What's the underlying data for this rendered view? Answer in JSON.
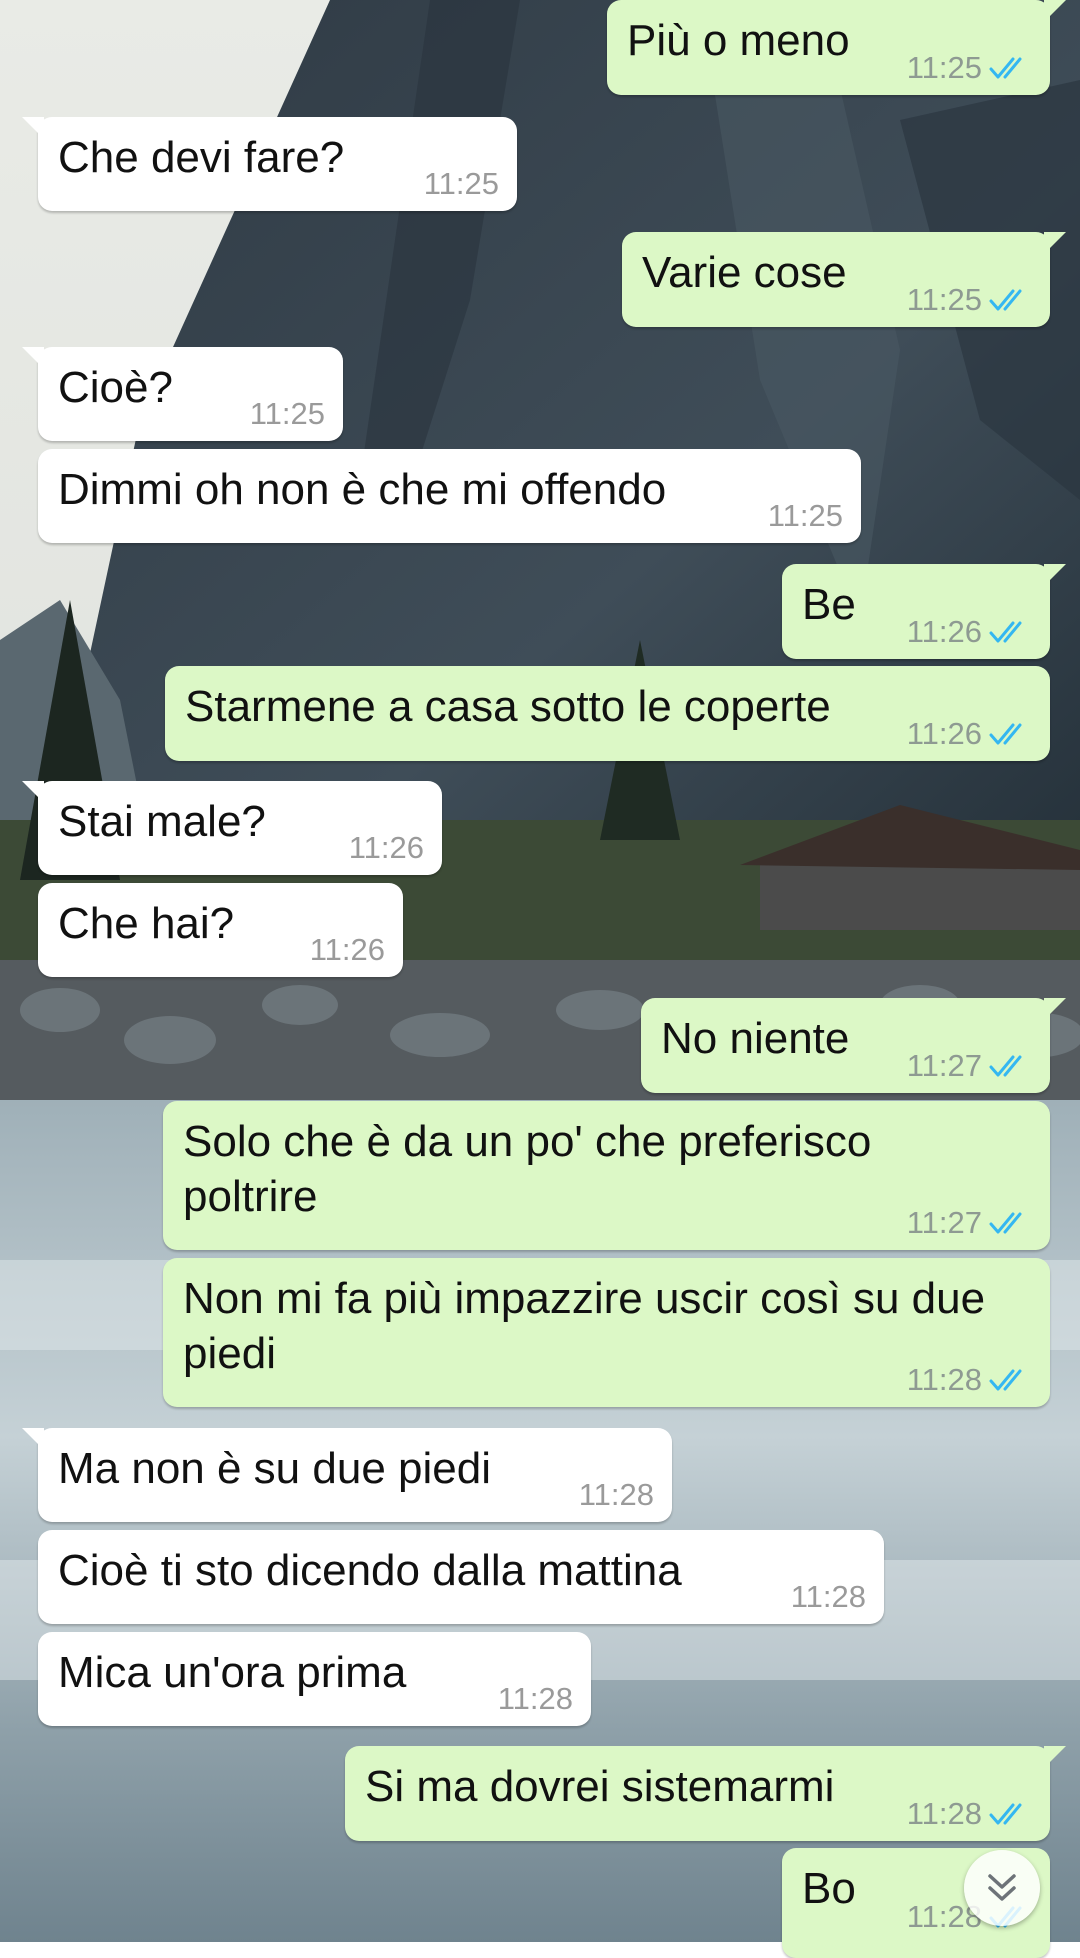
{
  "chat": {
    "messages": [
      {
        "dir": "out",
        "text": "Più o meno",
        "time": "11:25",
        "read": true
      },
      {
        "dir": "in",
        "text": "Che devi fare?",
        "time": "11:25"
      },
      {
        "dir": "out",
        "text": "Varie cose",
        "time": "11:25",
        "read": true
      },
      {
        "dir": "in",
        "text": "Cioè?",
        "time": "11:25"
      },
      {
        "dir": "in",
        "text": "Dimmi oh non è che mi offendo",
        "time": "11:25"
      },
      {
        "dir": "out",
        "text": "Be",
        "time": "11:26",
        "read": true
      },
      {
        "dir": "out",
        "text": "Starmene a casa sotto le coperte",
        "time": "11:26",
        "read": true
      },
      {
        "dir": "in",
        "text": "Stai male?",
        "time": "11:26"
      },
      {
        "dir": "in",
        "text": "Che hai?",
        "time": "11:26"
      },
      {
        "dir": "out",
        "text": "No niente",
        "time": "11:27",
        "read": true
      },
      {
        "dir": "out",
        "text": "Solo che è da un po' che preferisco\npoltrire",
        "time": "11:27",
        "read": true
      },
      {
        "dir": "out",
        "text": "Non mi fa più impazzire uscir così su due\npiedi",
        "time": "11:28",
        "read": true
      },
      {
        "dir": "in",
        "text": "Ma non è su due piedi",
        "time": "11:28"
      },
      {
        "dir": "in",
        "text": "Cioè ti sto dicendo dalla mattina",
        "time": "11:28"
      },
      {
        "dir": "in",
        "text": "Mica un'ora prima",
        "time": "11:28"
      },
      {
        "dir": "out",
        "text": "Si ma dovrei sistemarmi",
        "time": "11:28",
        "read": true
      },
      {
        "dir": "out",
        "text": "Bo",
        "time": "11:28",
        "read": true
      }
    ]
  },
  "icons": {
    "read_receipt": "double-check-icon",
    "scroll_down": "double-chevron-down-icon"
  },
  "colors": {
    "outgoing_bubble": "#dcf8c6",
    "incoming_bubble": "#ffffff",
    "read_tick": "#34b7f1",
    "timestamp": "#8e9a92"
  }
}
